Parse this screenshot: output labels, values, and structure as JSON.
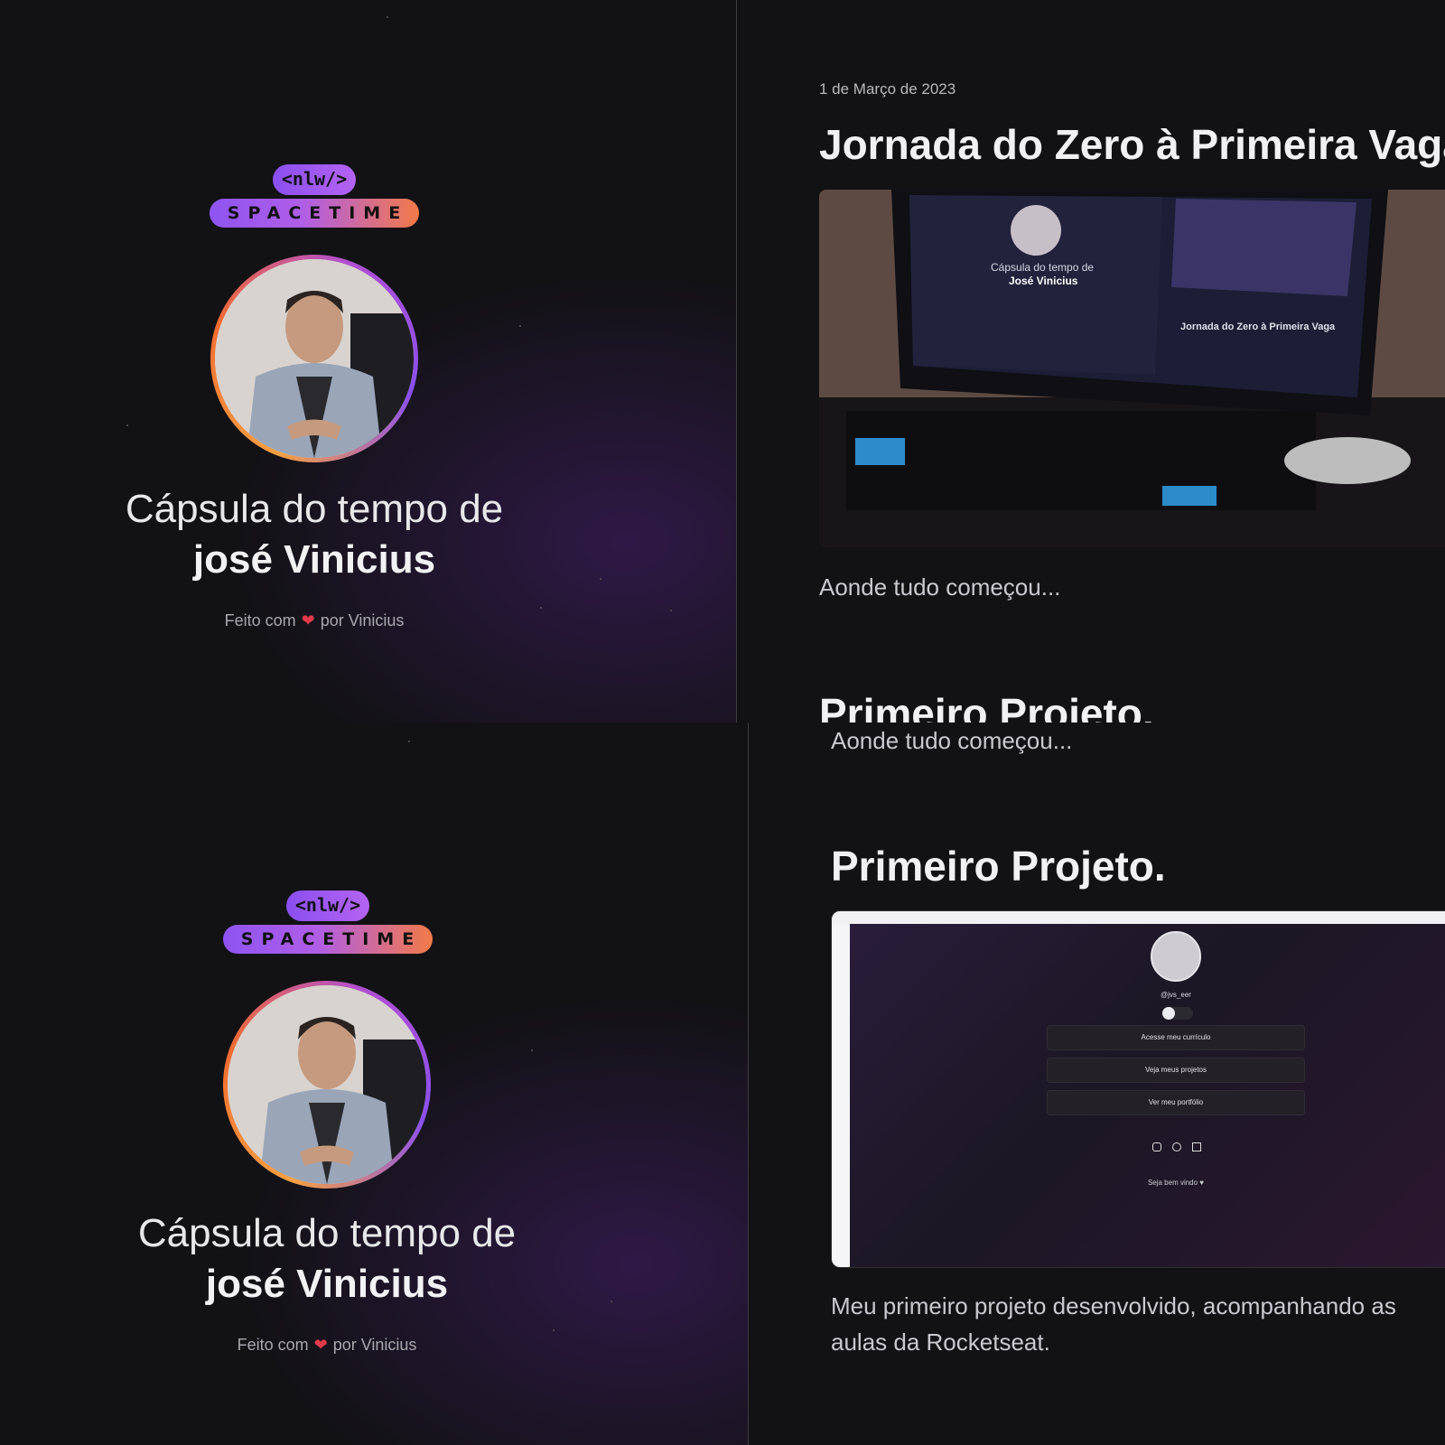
{
  "logo": {
    "tag": "<nlw/>",
    "brand": "SPACETIME"
  },
  "capsule": {
    "title_line": "Cápsula do tempo de",
    "owner_name": "josé Vinicius",
    "made_prefix": "Feito com",
    "made_suffix": "por Vinicius",
    "heart": "❤"
  },
  "memory": {
    "date": "1 de Março de 2023",
    "title": "Jornada do Zero à Primeira Vaga",
    "caption": "Aonde tudo começou..."
  },
  "next_memory": {
    "title": "Primeiro Projeto.",
    "description_line1": "Meu primeiro projeto desenvolvido, acompanhando as",
    "description_line2": "aulas da Rocketseat."
  },
  "mock_page": {
    "handle": "@jvs_eer",
    "buttons": [
      "Acesse meu currículo",
      "Veja meus projetos",
      "Ver meu portfólio"
    ],
    "footer": "Seja bem vindo ♥",
    "social_icons": [
      "instagram-icon",
      "github-icon",
      "linkedin-icon"
    ]
  },
  "colors": {
    "background": "#121215",
    "accent_purple": "#8a4ff0",
    "accent_orange": "#f27a48",
    "heart": "#e23a4a"
  }
}
